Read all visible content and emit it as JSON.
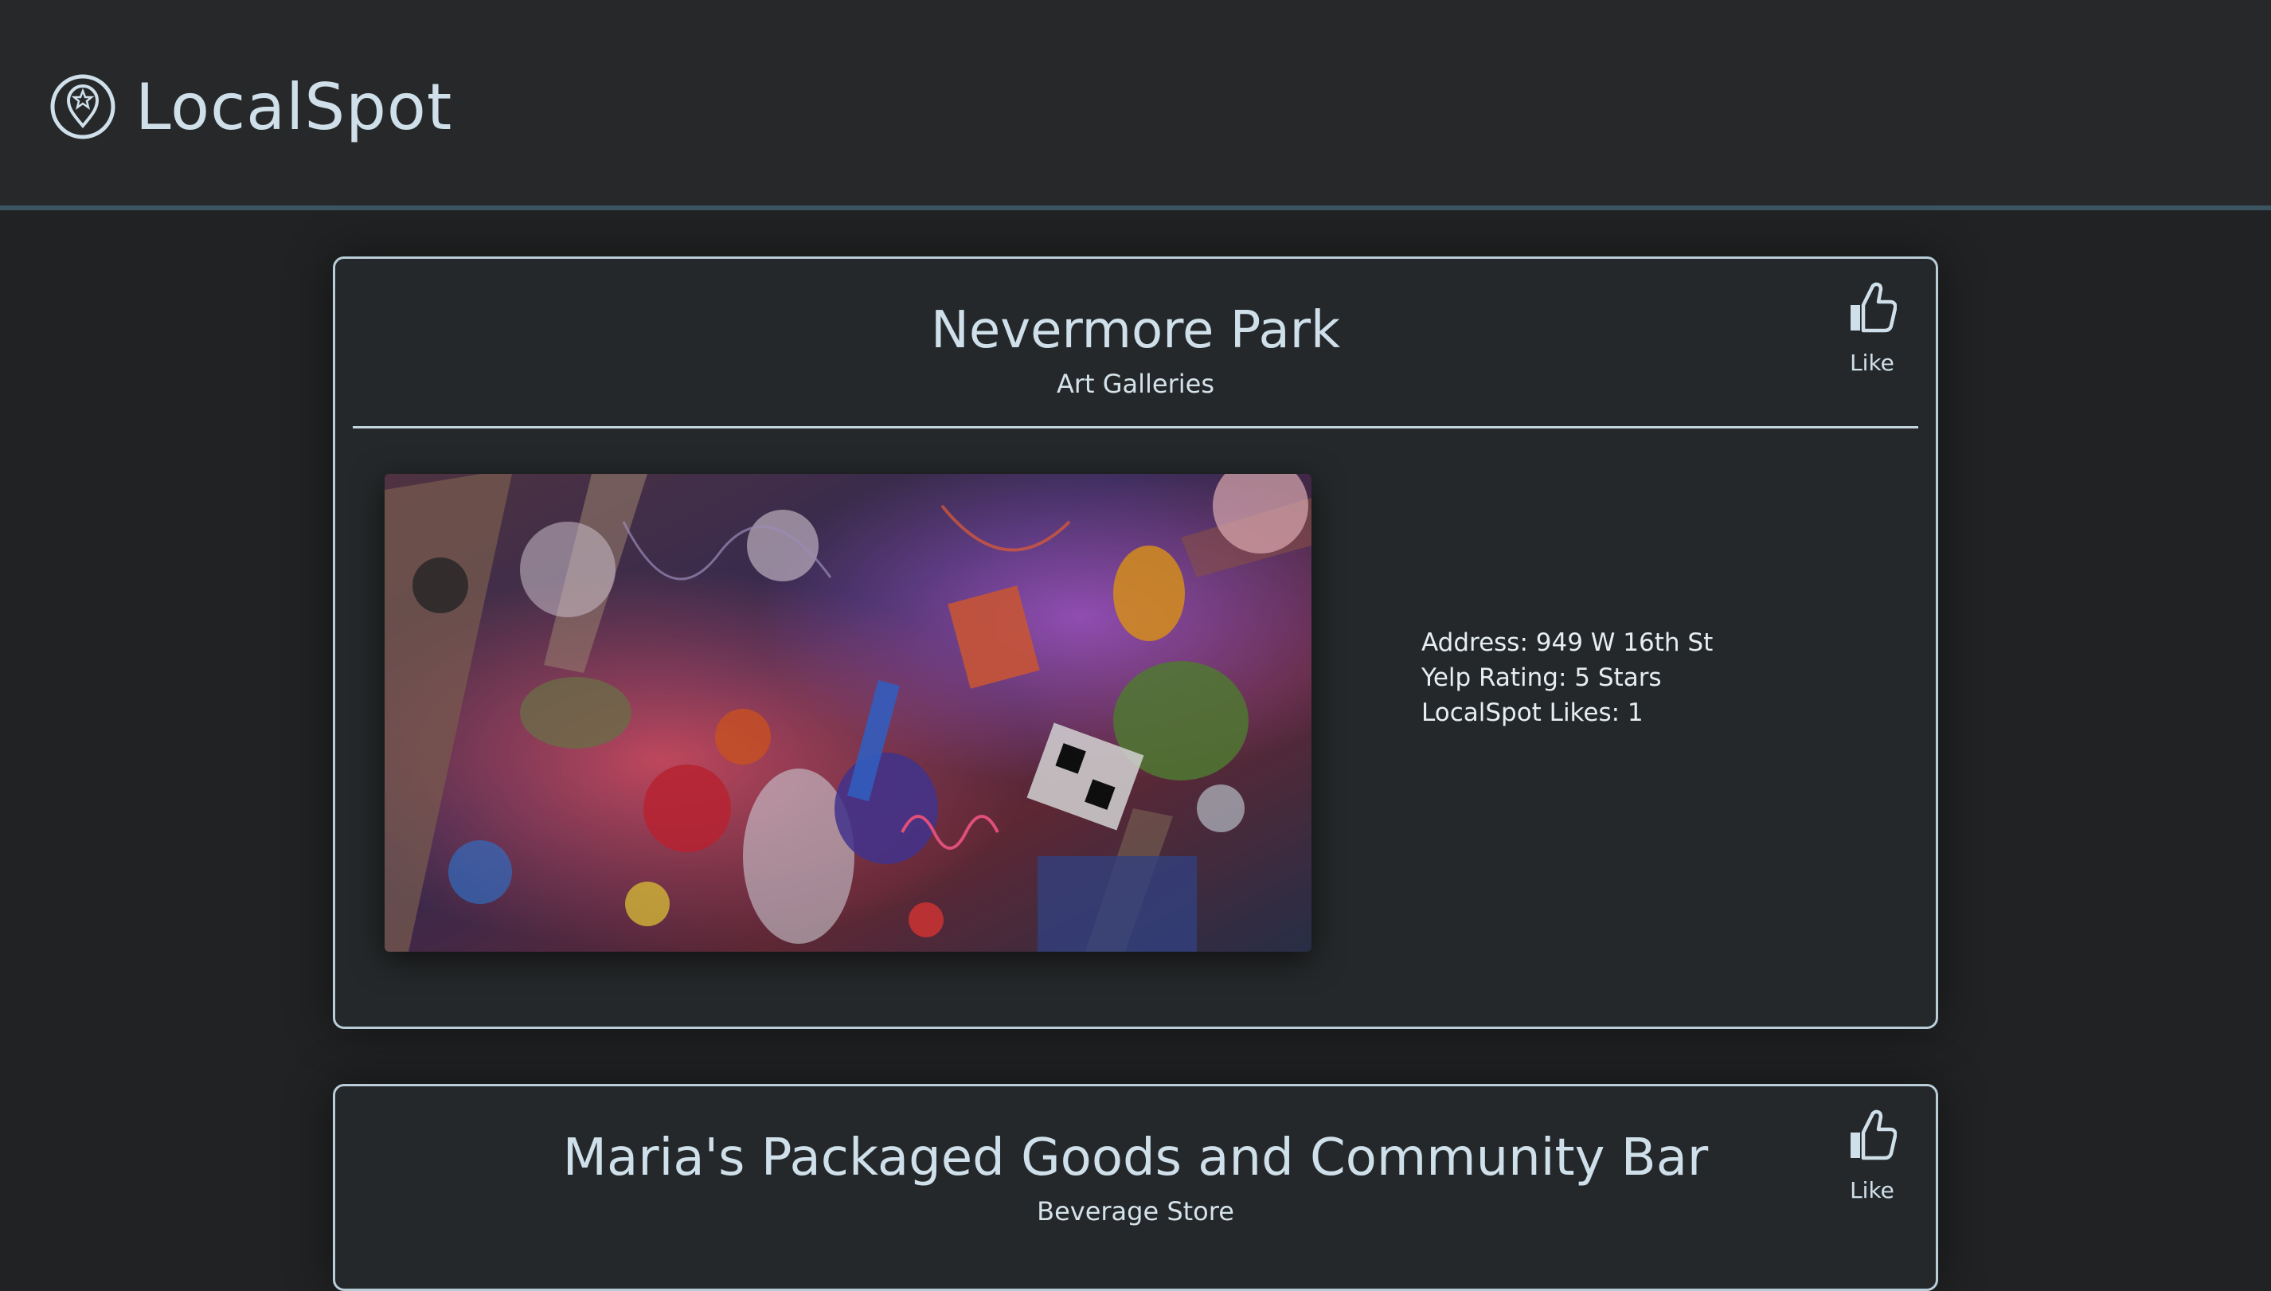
{
  "app": {
    "name": "LocalSpot",
    "logo_icon": "map-pin-star-icon"
  },
  "colors": {
    "background": "#212223",
    "header": "#272829",
    "header_border": "#3b5563",
    "card_border": "#b8cdd7",
    "text": "#cfe0ea"
  },
  "places": [
    {
      "name": "Nevermore Park",
      "category": "Art Galleries",
      "like_label": "Like",
      "like_icon": "thumbs-up-icon",
      "image_icon": "gallery-photo",
      "address": "Address: 949 W 16th St",
      "rating": "Yelp Rating: 5 Stars",
      "likes": "LocalSpot Likes: 1"
    },
    {
      "name": "Maria's Packaged Goods and Community Bar",
      "category": "Beverage Store",
      "like_label": "Like",
      "like_icon": "thumbs-up-icon"
    }
  ]
}
